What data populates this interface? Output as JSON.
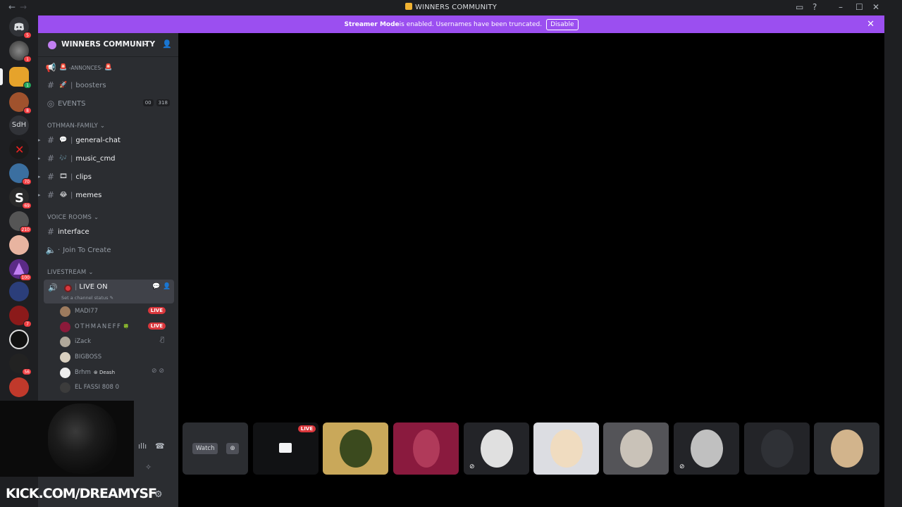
{
  "window": {
    "title": "WINNERS COMMUNITY",
    "back": "←",
    "forward": "→"
  },
  "banner": {
    "lead": "Streamer Mode",
    "text": " is enabled. Usernames have been truncated.",
    "disable": "Disable",
    "close": "✕"
  },
  "servers": [
    {
      "badge": "5"
    },
    {
      "badge": "1"
    },
    {
      "badge": "1"
    },
    {
      "badge": "8"
    },
    {
      "text": "SdH"
    },
    {
      "badge": ""
    },
    {
      "badge": "70"
    },
    {
      "badge": "69"
    },
    {
      "badge": "210"
    },
    {
      "badge": ""
    },
    {
      "badge": "100"
    },
    {
      "badge": ""
    },
    {
      "badge": "7"
    },
    {
      "badge": ""
    },
    {
      "badge": "56"
    },
    {
      "badge": ""
    }
  ],
  "guild": {
    "name": "WINNERS COMMUNITY"
  },
  "channels": {
    "annonces": "-ANNONCES-",
    "boosters": "boosters",
    "events": "EVENTS",
    "events_count_a": "00",
    "events_count_b": "318",
    "cat_family": "OTHMAN-FAMILY",
    "general": "general-chat",
    "music": "music_cmd",
    "clips": "clips",
    "memes": "memes",
    "cat_voice": "VOICE ROOMS",
    "interface": "interface",
    "join": "Join To Create",
    "cat_live": "LIVESTREAM",
    "live_on": "LIVE ON",
    "live_status": "Set a channel status"
  },
  "voice_users": [
    {
      "name": "MADI77",
      "live": "LIVE"
    },
    {
      "name": "OTHMANEFF",
      "live": "LIVE"
    },
    {
      "name": "iZack",
      "live": ""
    },
    {
      "name": "BIGBOSS",
      "live": ""
    },
    {
      "name": "Brhm",
      "tag": "Deash",
      "live": ""
    },
    {
      "name": "EL FASSI 808 0",
      "live": ""
    }
  ],
  "overlay": {
    "kick": "KICK.COM/DREAMYSF"
  },
  "stage": {
    "watch": "Watch",
    "live": "LIVE"
  },
  "colors": {
    "accent": "#9b4ff0",
    "live_red": "#da373c",
    "sidebar": "#2b2d31",
    "bg": "#1e1f22"
  }
}
